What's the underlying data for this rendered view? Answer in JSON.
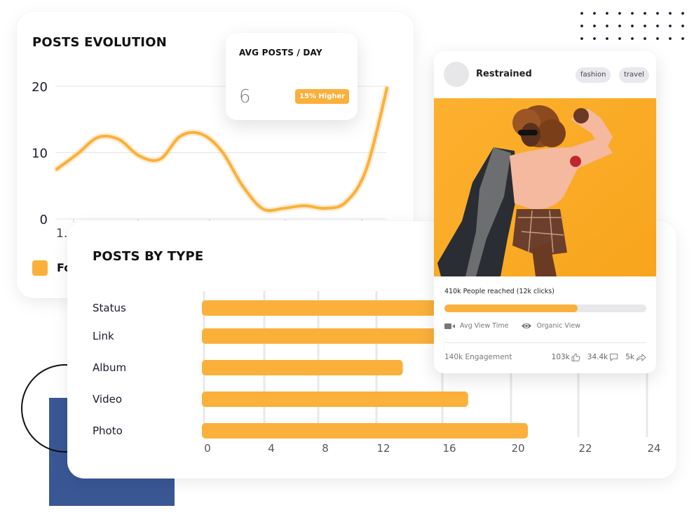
{
  "colors": {
    "accent": "#fbb03b",
    "deco_blue": "#3a5795",
    "dots": "#1a1a2e",
    "grid": "#e5e5ea",
    "text_dark": "#111111"
  },
  "posts_evolution": {
    "title": "POSTS EVOLUTION",
    "legend_label": "Fo",
    "x_label_visible": "1."
  },
  "avg_card": {
    "title": "AVG POSTS / DAY",
    "value": "6",
    "badge": "15% Higher"
  },
  "posts_by_type": {
    "title": "POSTS BY TYPE"
  },
  "post_card": {
    "username": "Restrained",
    "tags": [
      "fashion",
      "travel"
    ],
    "reach_text": "410k People reached (12k clicks)",
    "reach_progress": 0.66,
    "meta": [
      {
        "icon": "video-camera-icon",
        "label": "Avg View Time"
      },
      {
        "icon": "eye-icon",
        "label": "Organic View"
      }
    ],
    "engagement": "140k Engagement",
    "stats": [
      {
        "value": "103k",
        "icon": "thumbs-up-icon"
      },
      {
        "value": "34.4k",
        "icon": "comment-icon"
      },
      {
        "value": "5k",
        "icon": "share-icon"
      }
    ]
  },
  "chart_data": [
    {
      "type": "line",
      "title": "POSTS EVOLUTION",
      "xlabel": "",
      "ylabel": "",
      "ylim": [
        0,
        20
      ],
      "yticks": [
        "0",
        "10",
        "20"
      ],
      "x": [
        0,
        0.5,
        1,
        1.5,
        2,
        2.5,
        3,
        3.5,
        4,
        4.5,
        5,
        5.5,
        6,
        6.5,
        7,
        7.5,
        8,
        8.5,
        9,
        9.5,
        10
      ],
      "series": [
        {
          "name": "Fo",
          "values": [
            7.5,
            9.8,
            12.3,
            12.0,
            9.5,
            9.0,
            12.5,
            12.8,
            10.2,
            5.0,
            1.5,
            1.6,
            2.0,
            1.6,
            2.5,
            7.5,
            19.7
          ]
        }
      ],
      "grid": true,
      "legend": "bottom-left"
    },
    {
      "type": "bar",
      "orientation": "horizontal",
      "title": "POSTS BY TYPE",
      "categories": [
        "Status",
        "Link",
        "Album",
        "Video",
        "Photo"
      ],
      "values": [
        16,
        16,
        13.6,
        17.5,
        20.5
      ],
      "xticks": [
        "0",
        "4",
        "8",
        "12",
        "16",
        "20",
        "22",
        "24"
      ],
      "xlim": [
        0,
        24
      ],
      "grid": true
    }
  ]
}
